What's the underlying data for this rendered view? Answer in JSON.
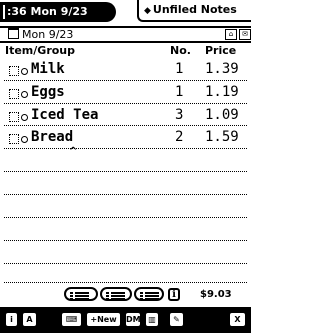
{
  "status": {
    "time_date": ":36 Mon 9/23",
    "folder_label": "Unfiled Notes"
  },
  "date_header": "Mon 9/23",
  "columns": {
    "item": "Item/Group",
    "no": "No.",
    "price": "Price"
  },
  "items": [
    {
      "name": "Milk",
      "qty": "1",
      "price": "1.39"
    },
    {
      "name": "Eggs",
      "qty": "1",
      "price": "1.19"
    },
    {
      "name": "Iced Tea",
      "qty": "3",
      "price": "1.09"
    },
    {
      "name": "Bread",
      "qty": "2",
      "price": "1.59"
    }
  ],
  "caret": "^",
  "total": "$9.03",
  "bottom_bar": {
    "new_label": "New",
    "dm_label": "DM",
    "info_glyph": "i",
    "a_glyph": "A",
    "close_glyph": "X"
  }
}
